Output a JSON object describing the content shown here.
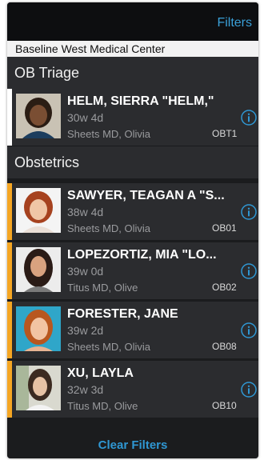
{
  "navbar": {
    "filters_label": "Filters"
  },
  "facility": {
    "name": "Baseline West Medical Center"
  },
  "sections": [
    {
      "title": "OB Triage"
    },
    {
      "title": "Obstetrics"
    }
  ],
  "patients": [
    {
      "name": "HELM, SIERRA \"HELM,\"",
      "gestation": "30w 4d",
      "provider": "Sheets MD, Olivia",
      "location": "OBT1",
      "stripe_color": "#ffffff"
    },
    {
      "name": "SAWYER, TEAGAN A \"S...",
      "gestation": "38w 4d",
      "provider": "Sheets MD, Olivia",
      "location": "OB01",
      "stripe_color": "#f5a623"
    },
    {
      "name": "LOPEZORTIZ, MIA \"LO...",
      "gestation": "39w 0d",
      "provider": "Titus MD, Olive",
      "location": "OB02",
      "stripe_color": "#f5a623"
    },
    {
      "name": "FORESTER, JANE",
      "gestation": "39w 2d",
      "provider": "Sheets MD, Olivia",
      "location": "OB08",
      "stripe_color": "#f5a623"
    },
    {
      "name": "XU, LAYLA",
      "gestation": "32w 3d",
      "provider": "Titus MD, Olive",
      "location": "OB10",
      "stripe_color": "#f5a623"
    }
  ],
  "footer": {
    "clear_label": "Clear Filters"
  },
  "colors": {
    "accent": "#2f97d3",
    "background": "#1b1c1e",
    "row": "#2b2c2f",
    "stripe_active": "#f5a623"
  }
}
